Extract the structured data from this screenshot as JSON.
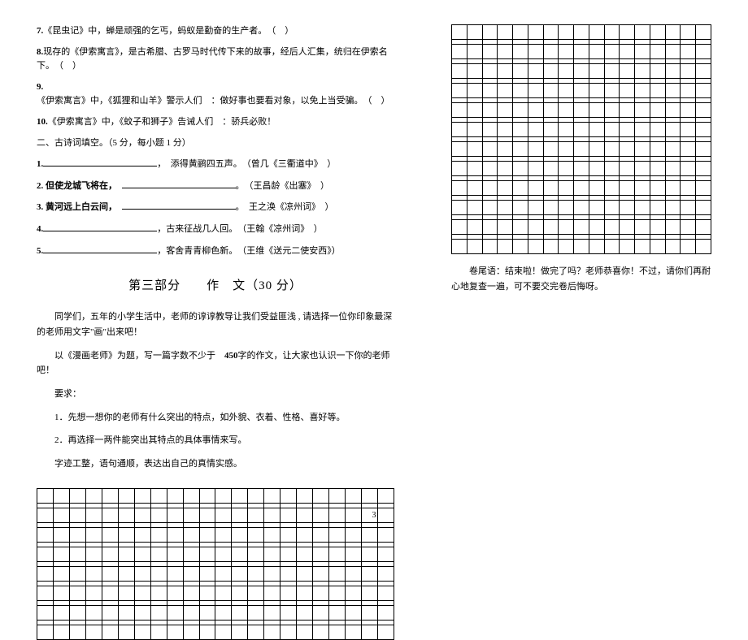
{
  "questions": {
    "q7": "7.《昆虫记》中，蝉是顽强的乞丐，蚂蚁是勤奋的生产者。　（　）",
    "q8": "8.现存的《伊索寓言》，是古希腊、古罗马时代传下来的故事，经后人汇集，统归在伊索名下。　（　）",
    "q9": "9.《伊索寓言》中，《狐狸和山羊》警示人们　：做好事也要看对象，以免上当受骗。　（　）",
    "q10_pre": "10.",
    "q10": "《伊索寓言》中，《蚊子和狮子》告诫人们　：骄兵必败！"
  },
  "poem": {
    "title": "二、古诗词填空。（5 分，每小题 1 分）",
    "p1_pre": "1.",
    "p1_suf": "，　添得黄鹂四五声。　（曾几《三衢道中》　）",
    "p2_pre": "2. 但使龙城飞将在，　",
    "p2_suf": "。　（王昌龄《出塞》　）",
    "p3_pre": "3. 黄河远上白云间，　",
    "p3_suf": "。　王之涣《凉州词》　）",
    "p4_pre": "4.",
    "p4_suf": "，古来征战几人回。　（王翰《凉州词》　）",
    "p5_pre": "5.",
    "p5_suf": "，客舍青青柳色新。　（王维《送元二使安西》）"
  },
  "composition": {
    "section_title": "第三部分　　作　文（30 分）",
    "intro": "同学们，五年的小学生活中，老师的谆谆教导让我们受益匪浅 , 请选择一位你印象最深的老师用文字\"画\"出来吧！",
    "topic_pre": "以《漫画老师》为题，写一篇字数不少于　",
    "topic_num": "450",
    "topic_suf": "字的作文，让大家也认识一下你的老师吧！",
    "requirements_label": "要求：",
    "req1": "1．先想一想你的老师有什么突出的特点，如外貌、衣着、性格、喜好等。",
    "req2": "2．再选择一两件能突出其特点的具体事情来写。",
    "req_final": "字迹工整，语句通顺，表达出自己的真情实感。"
  },
  "closing": {
    "text": "卷尾语：结束啦！做完了吗？老师恭喜你！不过，请你们再耐心地复查一遍，可不要交完卷后悔呀。"
  },
  "page_number": "3"
}
